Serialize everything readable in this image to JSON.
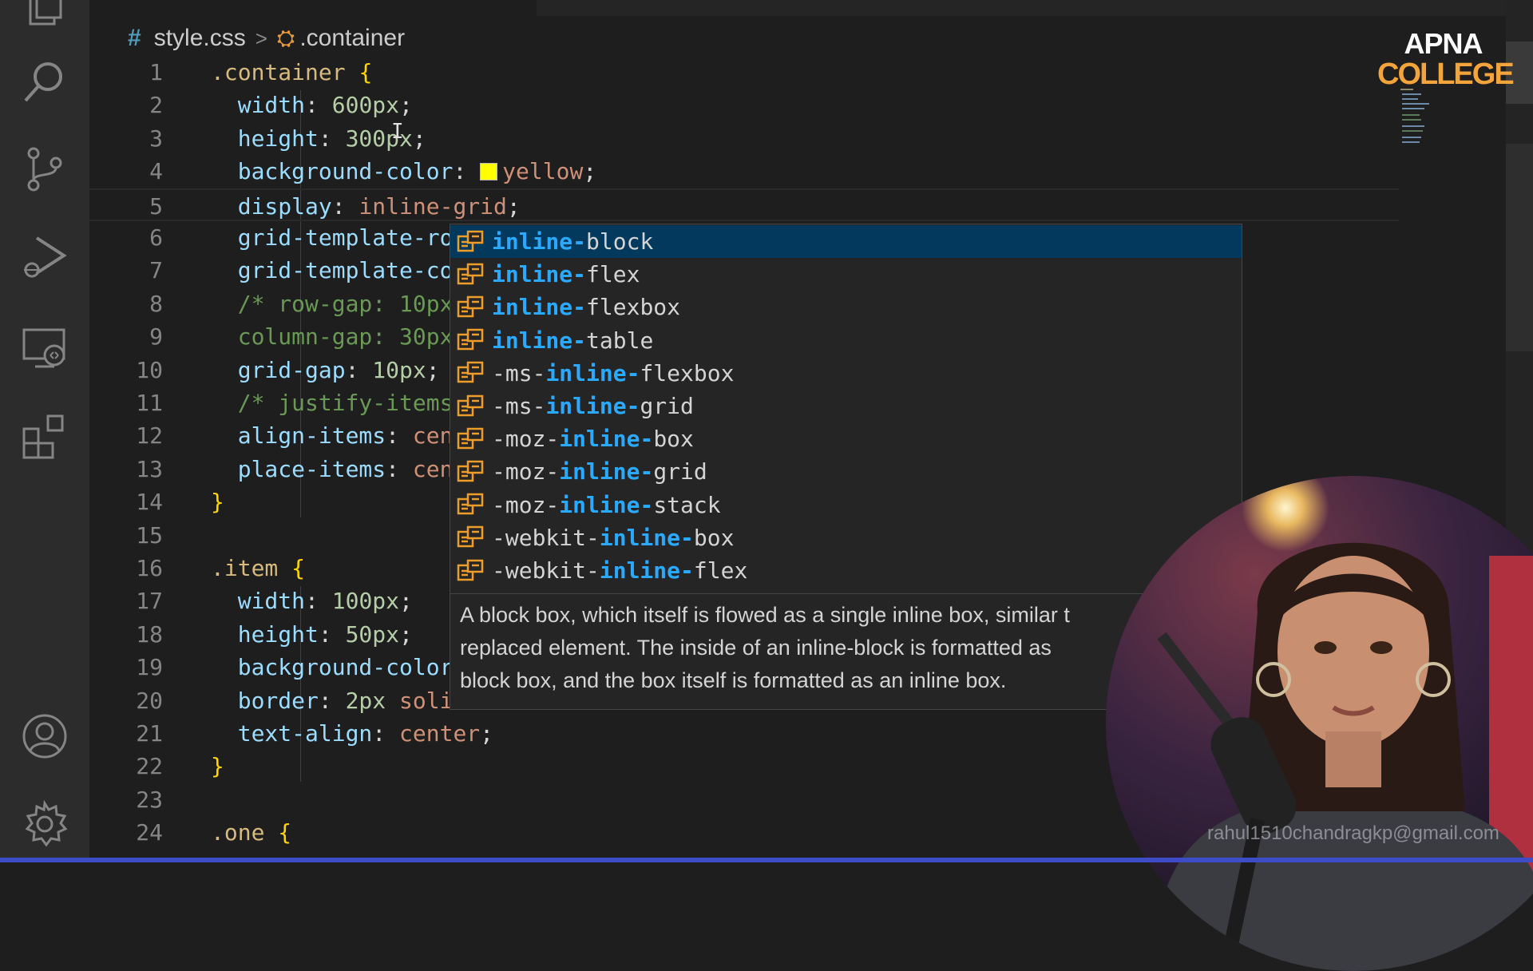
{
  "breadcrumb": {
    "hash": "#",
    "file": "style.css",
    "separator": ">",
    "symbol": ".container"
  },
  "editor": {
    "lines": [
      {
        "n": "1",
        "tokens": [
          {
            "t": ".container",
            "c": "sel"
          },
          {
            "t": " ",
            "c": "punc"
          },
          {
            "t": "{",
            "c": "brace"
          }
        ]
      },
      {
        "n": "2",
        "tokens": [
          {
            "t": "  width",
            "c": "prop"
          },
          {
            "t": ": ",
            "c": "punc"
          },
          {
            "t": "600px",
            "c": "num"
          },
          {
            "t": ";",
            "c": "punc"
          }
        ]
      },
      {
        "n": "3",
        "tokens": [
          {
            "t": "  height",
            "c": "prop"
          },
          {
            "t": ": ",
            "c": "punc"
          },
          {
            "t": "300px",
            "c": "num"
          },
          {
            "t": ";",
            "c": "punc"
          }
        ]
      },
      {
        "n": "4",
        "tokens": [
          {
            "t": "  background-color",
            "c": "prop"
          },
          {
            "t": ": ",
            "c": "punc"
          },
          {
            "t": "",
            "c": "swatch"
          },
          {
            "t": "yellow",
            "c": "val"
          },
          {
            "t": ";",
            "c": "punc"
          }
        ]
      },
      {
        "n": "5",
        "tokens": [
          {
            "t": "  display",
            "c": "prop"
          },
          {
            "t": ": ",
            "c": "punc"
          },
          {
            "t": "inline-grid",
            "c": "val"
          },
          {
            "t": ";",
            "c": "punc"
          }
        ]
      },
      {
        "n": "6",
        "tokens": [
          {
            "t": "  grid-template-ro",
            "c": "prop"
          }
        ]
      },
      {
        "n": "7",
        "tokens": [
          {
            "t": "  grid-template-co",
            "c": "prop"
          }
        ]
      },
      {
        "n": "8",
        "tokens": [
          {
            "t": "  /* row-gap: 10px",
            "c": "comment"
          }
        ]
      },
      {
        "n": "9",
        "tokens": [
          {
            "t": "  column-gap: 30px",
            "c": "comment"
          }
        ]
      },
      {
        "n": "10",
        "tokens": [
          {
            "t": "  grid-gap",
            "c": "prop"
          },
          {
            "t": ": ",
            "c": "punc"
          },
          {
            "t": "10px",
            "c": "num"
          },
          {
            "t": ";",
            "c": "punc"
          }
        ]
      },
      {
        "n": "11",
        "tokens": [
          {
            "t": "  /* justify-items",
            "c": "comment"
          }
        ]
      },
      {
        "n": "12",
        "tokens": [
          {
            "t": "  align-items",
            "c": "prop"
          },
          {
            "t": ": ",
            "c": "punc"
          },
          {
            "t": "cen",
            "c": "val"
          }
        ]
      },
      {
        "n": "13",
        "tokens": [
          {
            "t": "  place-items",
            "c": "prop"
          },
          {
            "t": ": ",
            "c": "punc"
          },
          {
            "t": "cen",
            "c": "val"
          }
        ]
      },
      {
        "n": "14",
        "tokens": [
          {
            "t": "}",
            "c": "brace"
          }
        ]
      },
      {
        "n": "15",
        "tokens": []
      },
      {
        "n": "16",
        "tokens": [
          {
            "t": ".item",
            "c": "sel"
          },
          {
            "t": " ",
            "c": "punc"
          },
          {
            "t": "{",
            "c": "brace"
          }
        ]
      },
      {
        "n": "17",
        "tokens": [
          {
            "t": "  width",
            "c": "prop"
          },
          {
            "t": ": ",
            "c": "punc"
          },
          {
            "t": "100px",
            "c": "num"
          },
          {
            "t": ";",
            "c": "punc"
          }
        ]
      },
      {
        "n": "18",
        "tokens": [
          {
            "t": "  height",
            "c": "prop"
          },
          {
            "t": ": ",
            "c": "punc"
          },
          {
            "t": "50px",
            "c": "num"
          },
          {
            "t": ";",
            "c": "punc"
          }
        ]
      },
      {
        "n": "19",
        "tokens": [
          {
            "t": "  background-color",
            "c": "prop"
          }
        ]
      },
      {
        "n": "20",
        "tokens": [
          {
            "t": "  border",
            "c": "prop"
          },
          {
            "t": ": ",
            "c": "punc"
          },
          {
            "t": "2px",
            "c": "num"
          },
          {
            "t": " ",
            "c": "punc"
          },
          {
            "t": "soli",
            "c": "val"
          }
        ]
      },
      {
        "n": "21",
        "tokens": [
          {
            "t": "  text-align",
            "c": "prop"
          },
          {
            "t": ": ",
            "c": "punc"
          },
          {
            "t": "center",
            "c": "val"
          },
          {
            "t": ";",
            "c": "punc"
          }
        ]
      },
      {
        "n": "22",
        "tokens": [
          {
            "t": "}",
            "c": "brace"
          }
        ]
      },
      {
        "n": "23",
        "tokens": []
      },
      {
        "n": "24",
        "tokens": [
          {
            "t": ".one",
            "c": "sel"
          },
          {
            "t": " ",
            "c": "punc"
          },
          {
            "t": "{",
            "c": "brace"
          }
        ]
      }
    ]
  },
  "suggest": {
    "items": [
      {
        "pre": "",
        "hl": "inline-",
        "post": "block",
        "selected": true
      },
      {
        "pre": "",
        "hl": "inline-",
        "post": "flex"
      },
      {
        "pre": "",
        "hl": "inline-",
        "post": "flexbox"
      },
      {
        "pre": "",
        "hl": "inline-",
        "post": "table"
      },
      {
        "pre": "-ms-",
        "hl": "inline-",
        "post": "flexbox"
      },
      {
        "pre": "-ms-",
        "hl": "inline-",
        "post": "grid"
      },
      {
        "pre": "-moz-",
        "hl": "inline-",
        "post": "box"
      },
      {
        "pre": "-moz-",
        "hl": "inline-",
        "post": "grid"
      },
      {
        "pre": "-moz-",
        "hl": "inline-",
        "post": "stack"
      },
      {
        "pre": "-webkit-",
        "hl": "inline-",
        "post": "box"
      },
      {
        "pre": "-webkit-",
        "hl": "inline-",
        "post": "flex"
      }
    ],
    "detail_lines": [
      "A block box, which itself is flowed as a single inline box, similar t",
      "replaced element. The inside of an inline-block is formatted as",
      "block box, and the box itself is formatted as an inline box."
    ]
  },
  "logo": {
    "line1": "APNA",
    "line2": "COLLEGE"
  },
  "watermark": "rahul1510chandragkp@gmail.com",
  "activity_icons": [
    "explorer-icon",
    "search-icon",
    "source-control-icon",
    "run-debug-icon",
    "remote-explorer-icon",
    "extensions-icon",
    "accounts-icon",
    "manage-gear-icon"
  ],
  "colors": {
    "accent_selected": "#04395e",
    "highlight": "#2aaaff",
    "status_bar": "#3f4cc8"
  }
}
